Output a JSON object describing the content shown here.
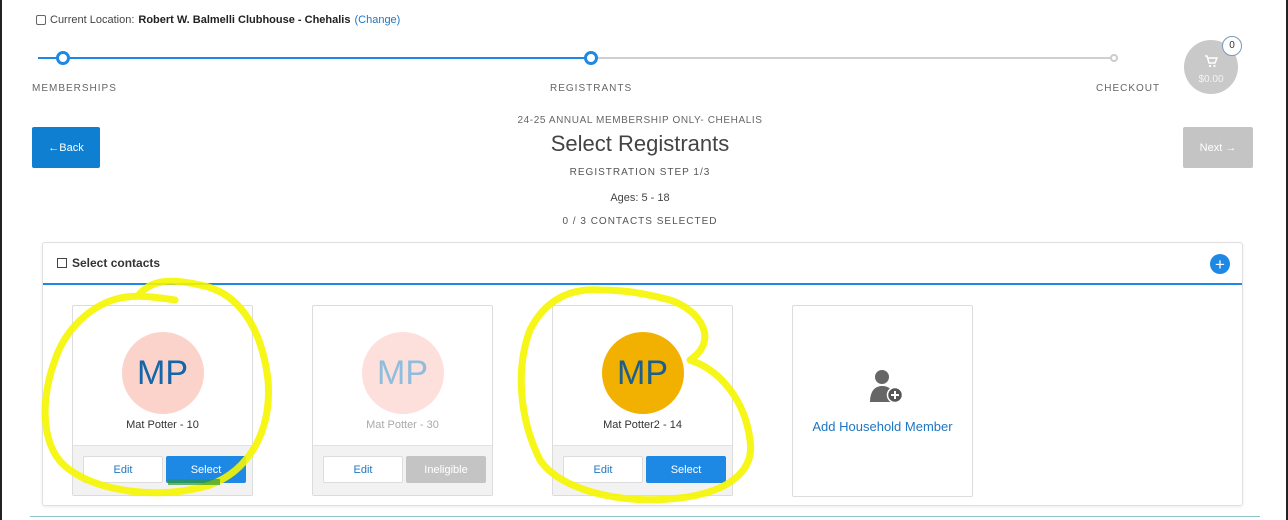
{
  "location": {
    "prefix": "Current Location:",
    "name": "Robert W. Balmelli Clubhouse - Chehalis",
    "change_link": "(Change)"
  },
  "steps": [
    {
      "label": "MEMBERSHIPS",
      "state": "complete"
    },
    {
      "label": "REGISTRANTS",
      "state": "current"
    },
    {
      "label": "CHECKOUT",
      "state": "pending"
    }
  ],
  "cart": {
    "count": "0",
    "total": "$0.00",
    "icon": "cart-icon"
  },
  "nav": {
    "back_label": "←Back",
    "next_label": "Next →"
  },
  "header": {
    "subtitle": "24-25 ANNUAL MEMBERSHIP ONLY- CHEHALIS",
    "title": "Select Registrants",
    "step": "REGISTRATION STEP 1/3",
    "ages": "Ages: 5 - 18",
    "selected_count": "0 / 3 CONTACTS SELECTED"
  },
  "panel": {
    "title": "Select contacts",
    "add_icon": "+"
  },
  "contacts": [
    {
      "initials": "MP",
      "name": "Mat Potter - 10",
      "edit_label": "Edit",
      "action_label": "Select",
      "eligible": true
    },
    {
      "initials": "MP",
      "name": "Mat Potter - 30",
      "edit_label": "Edit",
      "action_label": "Ineligible",
      "eligible": false
    },
    {
      "initials": "MP",
      "name": "Mat Potter2 - 14",
      "edit_label": "Edit",
      "action_label": "Select",
      "eligible": true
    }
  ],
  "add_member": {
    "label": "Add Household Member",
    "icon": "add-user-icon"
  },
  "colors": {
    "primary": "#1e88e5",
    "disabled": "#c4c4c4",
    "highlight": "#f5f500"
  }
}
